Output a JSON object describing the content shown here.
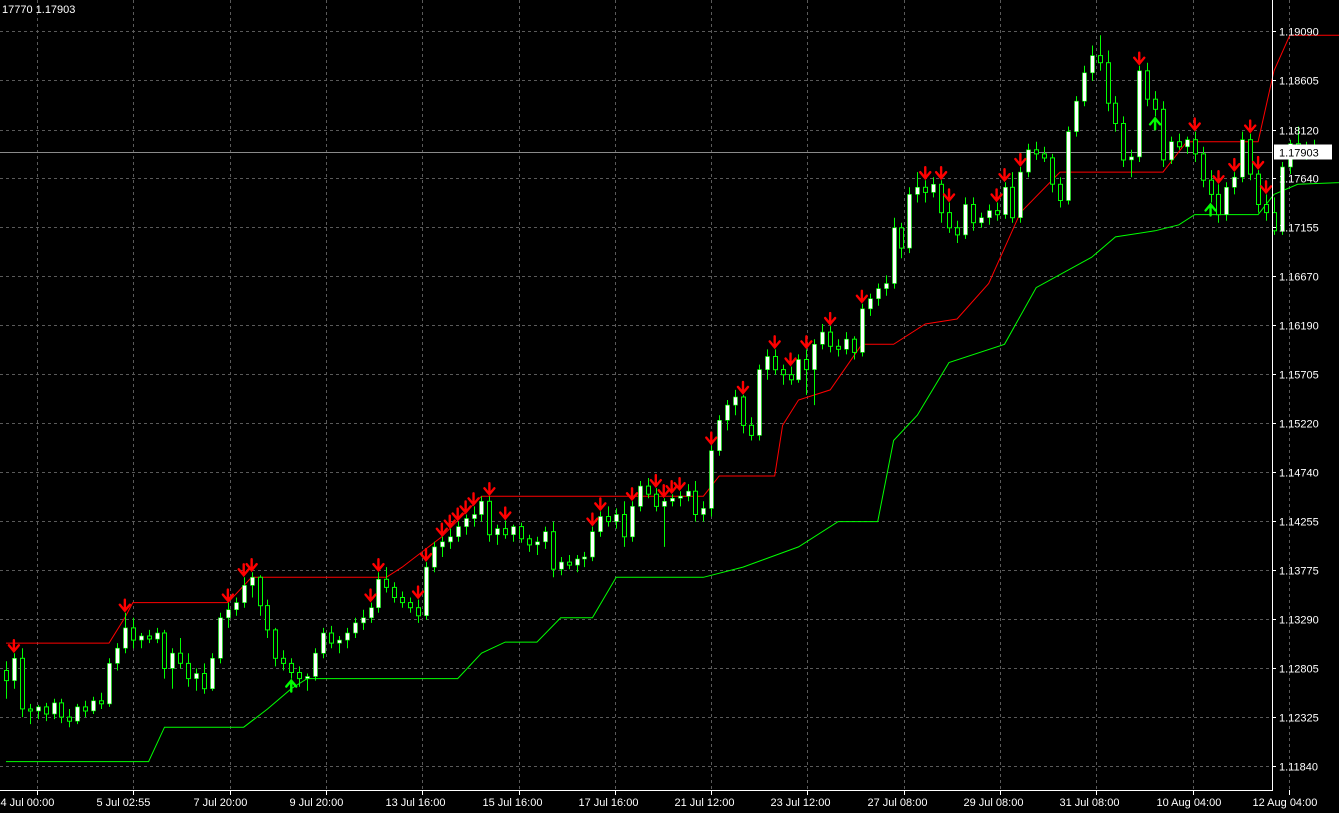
{
  "window": {
    "header_text": "17770 1.17903"
  },
  "colors": {
    "background": "#000000",
    "grid": "#5a5a5a",
    "axis": "#ffffff",
    "bull_candle": "#ffffff",
    "wick": "#00ff00",
    "upper_line": "#ff0000",
    "lower_line": "#00ff00",
    "sell_arrow": "#ff0000",
    "buy_arrow": "#00ff00",
    "current_price_line": "#8a8a8a"
  },
  "chart_data": {
    "type": "candlestick",
    "y_ticks": [
      "1.19090",
      "1.18605",
      "1.18120",
      "1.17640",
      "1.17155",
      "1.16670",
      "1.16190",
      "1.15705",
      "1.15220",
      "1.14740",
      "1.14255",
      "1.13775",
      "1.13290",
      "1.12805",
      "1.12325",
      "1.11840"
    ],
    "ylim": [
      1.1159,
      1.1932
    ],
    "x_ticks": [
      "4 Jul 00:00",
      "5 Jul 02:55",
      "7 Jul 20:00",
      "9 Jul 20:00",
      "13 Jul 16:00",
      "15 Jul 16:00",
      "17 Jul 16:00",
      "21 Jul 12:00",
      "23 Jul 12:00",
      "27 Jul 08:00",
      "29 Jul 08:00",
      "31 Jul 08:00",
      "10 Aug 04:00",
      "12 Aug 04:00"
    ],
    "current_price": 1.17903,
    "bar_count": 160,
    "candles": [
      [
        1.1278,
        1.1287,
        1.125,
        1.1268
      ],
      [
        1.1268,
        1.1295,
        1.126,
        1.129
      ],
      [
        1.129,
        1.13,
        1.1232,
        1.124
      ],
      [
        1.124,
        1.1245,
        1.1225,
        1.1238
      ],
      [
        1.1238,
        1.1244,
        1.123,
        1.1242
      ],
      [
        1.1242,
        1.1246,
        1.1228,
        1.1235
      ],
      [
        1.1235,
        1.125,
        1.123,
        1.1246
      ],
      [
        1.1246,
        1.125,
        1.1226,
        1.1232
      ],
      [
        1.1232,
        1.124,
        1.1222,
        1.1228
      ],
      [
        1.1228,
        1.1245,
        1.1225,
        1.1242
      ],
      [
        1.1242,
        1.1248,
        1.1232,
        1.1238
      ],
      [
        1.1238,
        1.1252,
        1.1235,
        1.1248
      ],
      [
        1.1248,
        1.1256,
        1.124,
        1.1245
      ],
      [
        1.1245,
        1.129,
        1.1242,
        1.1285
      ],
      [
        1.1285,
        1.1305,
        1.1278,
        1.13
      ],
      [
        1.13,
        1.1335,
        1.1295,
        1.132
      ],
      [
        1.132,
        1.133,
        1.13,
        1.1308
      ],
      [
        1.1308,
        1.1315,
        1.13,
        1.1312
      ],
      [
        1.1312,
        1.1318,
        1.1305,
        1.1309
      ],
      [
        1.1309,
        1.132,
        1.1305,
        1.1315
      ],
      [
        1.1315,
        1.1318,
        1.127,
        1.128
      ],
      [
        1.128,
        1.13,
        1.126,
        1.1295
      ],
      [
        1.1295,
        1.131,
        1.128,
        1.1285
      ],
      [
        1.1285,
        1.1295,
        1.1262,
        1.127
      ],
      [
        1.127,
        1.128,
        1.1258,
        1.1275
      ],
      [
        1.1275,
        1.1285,
        1.1255,
        1.126
      ],
      [
        1.126,
        1.1295,
        1.1258,
        1.129
      ],
      [
        1.129,
        1.1335,
        1.1285,
        1.133
      ],
      [
        1.133,
        1.1345,
        1.132,
        1.1338
      ],
      [
        1.1338,
        1.135,
        1.1332,
        1.1345
      ],
      [
        1.1345,
        1.137,
        1.134,
        1.1362
      ],
      [
        1.1362,
        1.1375,
        1.135,
        1.137
      ],
      [
        1.137,
        1.1372,
        1.1332,
        1.1342
      ],
      [
        1.1342,
        1.1348,
        1.131,
        1.1318
      ],
      [
        1.1318,
        1.132,
        1.1282,
        1.129
      ],
      [
        1.129,
        1.1298,
        1.1278,
        1.1285
      ],
      [
        1.1285,
        1.129,
        1.127,
        1.1276
      ],
      [
        1.1276,
        1.1282,
        1.1262,
        1.127
      ],
      [
        1.127,
        1.1275,
        1.1258,
        1.1272
      ],
      [
        1.1272,
        1.13,
        1.1268,
        1.1295
      ],
      [
        1.1295,
        1.132,
        1.129,
        1.1315
      ],
      [
        1.1315,
        1.1322,
        1.13,
        1.1305
      ],
      [
        1.1305,
        1.1312,
        1.1295,
        1.1308
      ],
      [
        1.1308,
        1.132,
        1.13,
        1.1315
      ],
      [
        1.1315,
        1.133,
        1.131,
        1.1325
      ],
      [
        1.1325,
        1.1338,
        1.1318,
        1.133
      ],
      [
        1.133,
        1.1345,
        1.1325,
        1.134
      ],
      [
        1.134,
        1.1375,
        1.1335,
        1.1368
      ],
      [
        1.1368,
        1.138,
        1.1355,
        1.136
      ],
      [
        1.136,
        1.1365,
        1.1345,
        1.135
      ],
      [
        1.135,
        1.1356,
        1.134,
        1.1345
      ],
      [
        1.1345,
        1.135,
        1.1335,
        1.134
      ],
      [
        1.134,
        1.1348,
        1.1325,
        1.1332
      ],
      [
        1.1332,
        1.1385,
        1.1328,
        1.138
      ],
      [
        1.138,
        1.1405,
        1.1375,
        1.14
      ],
      [
        1.14,
        1.141,
        1.139,
        1.1405
      ],
      [
        1.1405,
        1.1418,
        1.1398,
        1.141
      ],
      [
        1.141,
        1.1425,
        1.1405,
        1.142
      ],
      [
        1.142,
        1.1432,
        1.1412,
        1.1428
      ],
      [
        1.1428,
        1.144,
        1.142,
        1.1432
      ],
      [
        1.1432,
        1.145,
        1.1425,
        1.1445
      ],
      [
        1.1445,
        1.145,
        1.1405,
        1.1412
      ],
      [
        1.1412,
        1.1422,
        1.1402,
        1.1418
      ],
      [
        1.1418,
        1.1426,
        1.1408,
        1.1412
      ],
      [
        1.1412,
        1.1422,
        1.1405,
        1.142
      ],
      [
        1.142,
        1.1424,
        1.1404,
        1.1408
      ],
      [
        1.1408,
        1.1412,
        1.1395,
        1.1402
      ],
      [
        1.1402,
        1.141,
        1.1392,
        1.1405
      ],
      [
        1.1405,
        1.142,
        1.1398,
        1.1415
      ],
      [
        1.1415,
        1.1425,
        1.137,
        1.1378
      ],
      [
        1.1378,
        1.139,
        1.1372,
        1.1385
      ],
      [
        1.1385,
        1.1392,
        1.1378,
        1.1382
      ],
      [
        1.1382,
        1.1392,
        1.1375,
        1.1388
      ],
      [
        1.1388,
        1.1395,
        1.138,
        1.139
      ],
      [
        1.139,
        1.142,
        1.1386,
        1.1415
      ],
      [
        1.1415,
        1.1435,
        1.141,
        1.143
      ],
      [
        1.143,
        1.144,
        1.142,
        1.1425
      ],
      [
        1.1425,
        1.1438,
        1.1418,
        1.1432
      ],
      [
        1.1432,
        1.1445,
        1.14,
        1.141
      ],
      [
        1.141,
        1.1445,
        1.1405,
        1.144
      ],
      [
        1.144,
        1.1465,
        1.1435,
        1.146
      ],
      [
        1.146,
        1.1468,
        1.1448,
        1.1452
      ],
      [
        1.1452,
        1.1458,
        1.1435,
        1.144
      ],
      [
        1.144,
        1.1448,
        1.14,
        1.1445
      ],
      [
        1.1445,
        1.1452,
        1.144,
        1.1448
      ],
      [
        1.1448,
        1.1455,
        1.144,
        1.145
      ],
      [
        1.145,
        1.1462,
        1.1445,
        1.1455
      ],
      [
        1.1455,
        1.1465,
        1.1425,
        1.1432
      ],
      [
        1.1432,
        1.1445,
        1.1425,
        1.1438
      ],
      [
        1.1438,
        1.15,
        1.143,
        1.1495
      ],
      [
        1.1495,
        1.153,
        1.149,
        1.1525
      ],
      [
        1.1525,
        1.1545,
        1.1515,
        1.154
      ],
      [
        1.154,
        1.1555,
        1.153,
        1.1548
      ],
      [
        1.1548,
        1.155,
        1.1512,
        1.152
      ],
      [
        1.152,
        1.1528,
        1.1505,
        1.151
      ],
      [
        1.151,
        1.158,
        1.1505,
        1.1575
      ],
      [
        1.1575,
        1.1595,
        1.1565,
        1.1588
      ],
      [
        1.1588,
        1.1595,
        1.157,
        1.1575
      ],
      [
        1.1575,
        1.158,
        1.156,
        1.157
      ],
      [
        1.157,
        1.1578,
        1.156,
        1.1565
      ],
      [
        1.1565,
        1.159,
        1.1562,
        1.1585
      ],
      [
        1.1585,
        1.1595,
        1.155,
        1.1575
      ],
      [
        1.1575,
        1.1605,
        1.154,
        1.16
      ],
      [
        1.16,
        1.162,
        1.1595,
        1.1612
      ],
      [
        1.1612,
        1.1618,
        1.1592,
        1.1598
      ],
      [
        1.1598,
        1.1605,
        1.1588,
        1.1595
      ],
      [
        1.1595,
        1.1612,
        1.159,
        1.1605
      ],
      [
        1.1605,
        1.1608,
        1.1585,
        1.1592
      ],
      [
        1.1592,
        1.164,
        1.1588,
        1.1635
      ],
      [
        1.1635,
        1.165,
        1.1628,
        1.1645
      ],
      [
        1.1645,
        1.166,
        1.1638,
        1.1655
      ],
      [
        1.1655,
        1.1668,
        1.1648,
        1.166
      ],
      [
        1.166,
        1.1725,
        1.1655,
        1.1715
      ],
      [
        1.1715,
        1.172,
        1.1685,
        1.1695
      ],
      [
        1.1695,
        1.1755,
        1.169,
        1.1748
      ],
      [
        1.1748,
        1.177,
        1.174,
        1.1755
      ],
      [
        1.1755,
        1.1762,
        1.174,
        1.175
      ],
      [
        1.175,
        1.1765,
        1.1745,
        1.1758
      ],
      [
        1.1758,
        1.1762,
        1.172,
        1.173
      ],
      [
        1.173,
        1.174,
        1.171,
        1.1715
      ],
      [
        1.1715,
        1.1722,
        1.17,
        1.1708
      ],
      [
        1.1708,
        1.1745,
        1.1704,
        1.1738
      ],
      [
        1.1738,
        1.1745,
        1.1712,
        1.172
      ],
      [
        1.172,
        1.173,
        1.1715,
        1.1725
      ],
      [
        1.1725,
        1.1738,
        1.1718,
        1.1732
      ],
      [
        1.1732,
        1.174,
        1.1722,
        1.1728
      ],
      [
        1.1728,
        1.176,
        1.1724,
        1.1755
      ],
      [
        1.1755,
        1.177,
        1.172,
        1.1725
      ],
      [
        1.1725,
        1.1775,
        1.172,
        1.177
      ],
      [
        1.177,
        1.1798,
        1.1765,
        1.1792
      ],
      [
        1.1792,
        1.18,
        1.1782,
        1.1788
      ],
      [
        1.1788,
        1.1795,
        1.178,
        1.1784
      ],
      [
        1.1784,
        1.1788,
        1.175,
        1.1758
      ],
      [
        1.1758,
        1.1765,
        1.1735,
        1.1742
      ],
      [
        1.1742,
        1.1815,
        1.1738,
        1.181
      ],
      [
        1.181,
        1.1845,
        1.1805,
        1.184
      ],
      [
        1.184,
        1.1875,
        1.1835,
        1.1868
      ],
      [
        1.1868,
        1.1895,
        1.186,
        1.1885
      ],
      [
        1.1885,
        1.1905,
        1.187,
        1.1878
      ],
      [
        1.1878,
        1.189,
        1.183,
        1.1838
      ],
      [
        1.1838,
        1.1845,
        1.181,
        1.1818
      ],
      [
        1.1818,
        1.1825,
        1.1775,
        1.1782
      ],
      [
        1.1782,
        1.1792,
        1.1765,
        1.1785
      ],
      [
        1.1785,
        1.1875,
        1.178,
        1.187
      ],
      [
        1.187,
        1.1878,
        1.1835,
        1.1842
      ],
      [
        1.1842,
        1.185,
        1.1825,
        1.1832
      ],
      [
        1.1832,
        1.184,
        1.1775,
        1.1782
      ],
      [
        1.1782,
        1.1805,
        1.1778,
        1.18
      ],
      [
        1.18,
        1.1808,
        1.1792,
        1.1795
      ],
      [
        1.1795,
        1.1805,
        1.1788,
        1.1802
      ],
      [
        1.1802,
        1.181,
        1.178,
        1.1788
      ],
      [
        1.1788,
        1.1795,
        1.1755,
        1.1762
      ],
      [
        1.1762,
        1.1772,
        1.174,
        1.1748
      ],
      [
        1.1748,
        1.1758,
        1.172,
        1.1728
      ],
      [
        1.1728,
        1.176,
        1.1722,
        1.1755
      ],
      [
        1.1755,
        1.177,
        1.1748,
        1.1765
      ],
      [
        1.1765,
        1.181,
        1.176,
        1.1802
      ],
      [
        1.1802,
        1.1808,
        1.1762,
        1.1768
      ],
      [
        1.1768,
        1.1772,
        1.173,
        1.1738
      ],
      [
        1.1738,
        1.1748,
        1.1722,
        1.173
      ],
      [
        1.173,
        1.1745,
        1.1708,
        1.1712
      ],
      [
        1.1712,
        1.178,
        1.1708,
        1.1775
      ],
      [
        1.1775,
        1.1802,
        1.1768,
        1.1798
      ],
      [
        1.1798,
        1.1815,
        1.1785,
        1.179
      ],
      [
        1.179,
        1.18,
        1.1782,
        1.1795
      ],
      [
        1.1795,
        1.1802,
        1.1788,
        1.179
      ]
    ],
    "upper_line": [
      [
        0,
        1.1305
      ],
      [
        13,
        1.1305
      ],
      [
        15,
        1.133
      ],
      [
        16,
        1.1345
      ],
      [
        28,
        1.1345
      ],
      [
        31,
        1.137
      ],
      [
        48,
        1.137
      ],
      [
        50,
        1.138
      ],
      [
        55,
        1.141
      ],
      [
        60,
        1.145
      ],
      [
        88,
        1.145
      ],
      [
        90,
        1.147
      ],
      [
        97,
        1.147
      ],
      [
        98,
        1.152
      ],
      [
        100,
        1.1545
      ],
      [
        104,
        1.1555
      ],
      [
        108,
        1.16
      ],
      [
        112,
        1.16
      ],
      [
        116,
        1.162
      ],
      [
        120,
        1.1625
      ],
      [
        124,
        1.166
      ],
      [
        128,
        1.173
      ],
      [
        133,
        1.177
      ],
      [
        146,
        1.177
      ],
      [
        149,
        1.18
      ],
      [
        158,
        1.18
      ],
      [
        160,
        1.187
      ],
      [
        162,
        1.1905
      ],
      [
        179,
        1.1905
      ],
      [
        182,
        1.188
      ],
      [
        186,
        1.1878
      ]
    ],
    "lower_line": [
      [
        0,
        1.1188
      ],
      [
        18,
        1.1188
      ],
      [
        20,
        1.1222
      ],
      [
        30,
        1.1222
      ],
      [
        33,
        1.124
      ],
      [
        36,
        1.126
      ],
      [
        38,
        1.127
      ],
      [
        57,
        1.127
      ],
      [
        60,
        1.1295
      ],
      [
        63,
        1.1306
      ],
      [
        67,
        1.1306
      ],
      [
        70,
        1.133
      ],
      [
        74,
        1.133
      ],
      [
        77,
        1.137
      ],
      [
        88,
        1.137
      ],
      [
        93,
        1.138
      ],
      [
        100,
        1.14
      ],
      [
        105,
        1.1425
      ],
      [
        110,
        1.1425
      ],
      [
        112,
        1.1505
      ],
      [
        115,
        1.153
      ],
      [
        119,
        1.1582
      ],
      [
        126,
        1.16
      ],
      [
        130,
        1.1656
      ],
      [
        137,
        1.1686
      ],
      [
        140,
        1.1706
      ],
      [
        145,
        1.1712
      ],
      [
        148,
        1.1718
      ],
      [
        150,
        1.1728
      ],
      [
        158,
        1.1728
      ],
      [
        160,
        1.1748
      ],
      [
        163,
        1.1758
      ],
      [
        176,
        1.1762
      ],
      [
        179,
        1.1758
      ],
      [
        186,
        1.1755
      ]
    ],
    "sell_arrows": [
      1,
      15,
      28,
      30,
      31,
      46,
      47,
      52,
      53,
      55,
      56,
      57,
      58,
      59,
      61,
      63,
      74,
      75,
      79,
      82,
      83,
      84,
      85,
      89,
      93,
      97,
      99,
      101,
      104,
      108,
      116,
      118,
      119,
      125,
      126,
      128,
      143,
      150,
      153,
      155,
      157,
      158,
      159
    ],
    "buy_arrows": [
      36,
      145,
      152
    ]
  }
}
